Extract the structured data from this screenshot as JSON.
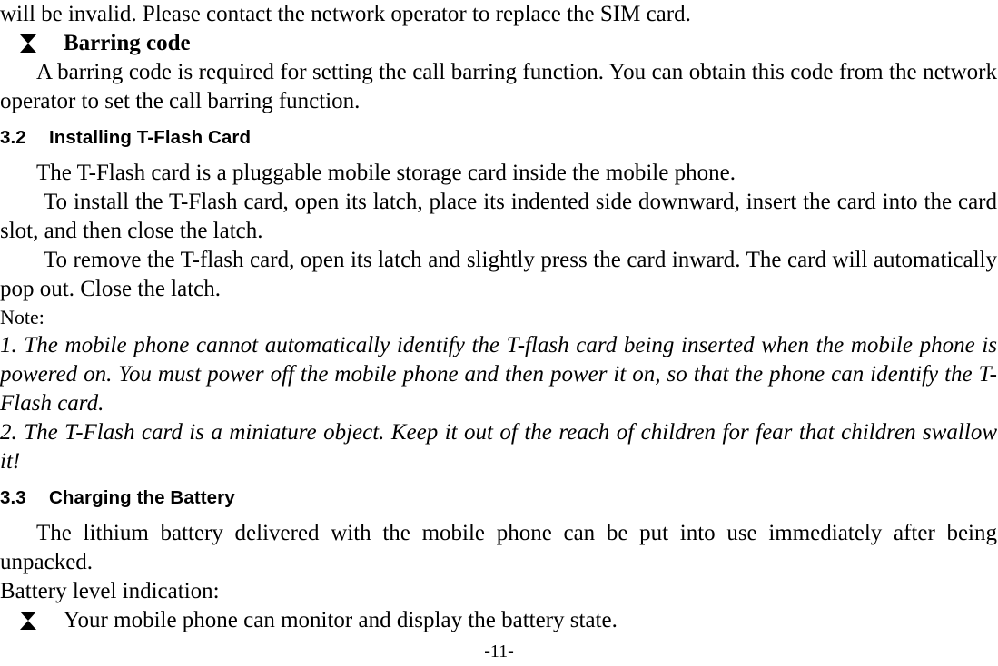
{
  "document": {
    "page_number_label": "-11-",
    "bullet_glyph": "diamond-filled"
  },
  "content": {
    "carryover_line": "will be invalid. Please contact the network operator to replace the SIM card.",
    "barring_bullet": {
      "label": "Barring code",
      "paragraph": "A barring code is required for setting the call barring function. You can obtain this code from the network operator to set the call barring function."
    },
    "section_3_2": {
      "number": "3.2",
      "title": "Installing T-Flash Card",
      "paragraph_1": "The T-Flash card is a pluggable mobile storage card inside the mobile phone.",
      "paragraph_2": "To install the T-Flash card, open its latch, place its indented side downward, insert the card into the card slot, and then close the latch.",
      "paragraph_3": "To remove the T-flash card, open its latch and slightly press the card inward. The card will automatically pop out. Close the latch.",
      "note_label": "Note:",
      "note_item_1": "1. The mobile phone cannot automatically identify the T-flash card being inserted when the mobile phone is powered on. You must power off the mobile phone and then power it on, so that the phone can identify the T-Flash card.",
      "note_item_2": "2. The T-Flash card is a miniature object. Keep it out of the reach of children for fear that children swallow it!"
    },
    "section_3_3": {
      "number": "3.3",
      "title": "Charging the Battery",
      "paragraph_1": "The lithium battery delivered with the mobile phone can be put into use immediately after being unpacked.",
      "battery_level_label": "Battery level indication:",
      "battery_bullet": "Your mobile phone can monitor and display the battery state."
    }
  }
}
